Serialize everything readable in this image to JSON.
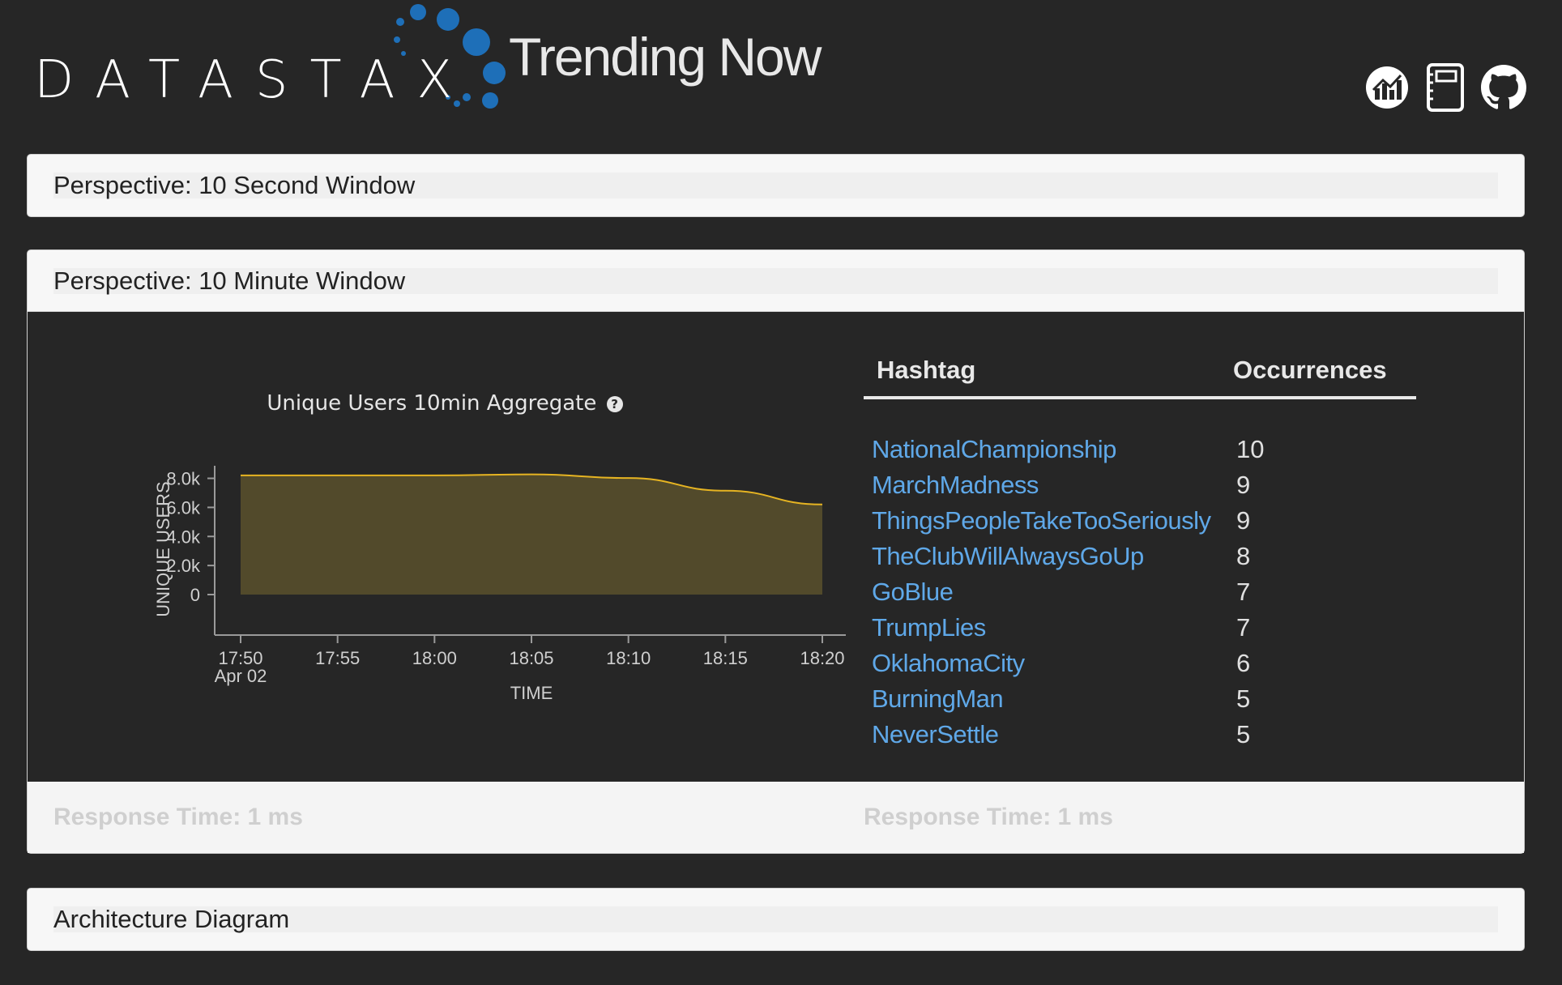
{
  "header": {
    "brand": "DATASTAX",
    "app_title": "Trending Now",
    "icons": [
      "analytics-icon",
      "notebook-icon",
      "github-icon"
    ]
  },
  "panels": {
    "second_window": {
      "title": "Perspective: 10 Second Window"
    },
    "minute_window": {
      "title": "Perspective: 10 Minute Window",
      "chart_title": "Unique Users 10min Aggregate",
      "footer_left": "Response Time: 1 ms",
      "footer_right": "Response Time: 1 ms"
    },
    "architecture": {
      "title": "Architecture Diagram"
    }
  },
  "hashtags": {
    "header_tag": "Hashtag",
    "header_count": "Occurrences",
    "rows": [
      {
        "tag": "NationalChampionship",
        "count": "10"
      },
      {
        "tag": "MarchMadness",
        "count": "9"
      },
      {
        "tag": "ThingsPeopleTakeTooSeriously",
        "count": "9"
      },
      {
        "tag": "TheClubWillAlwaysGoUp",
        "count": "8"
      },
      {
        "tag": "GoBlue",
        "count": "7"
      },
      {
        "tag": "TrumpLies",
        "count": "7"
      },
      {
        "tag": "OklahomaCity",
        "count": "6"
      },
      {
        "tag": "BurningMan",
        "count": "5"
      },
      {
        "tag": "NeverSettle",
        "count": "5"
      }
    ]
  },
  "chart_data": {
    "type": "area",
    "title": "Unique Users 10min Aggregate",
    "xlabel": "TIME",
    "ylabel": "UNIQUE USERS",
    "x": [
      "17:50",
      "17:55",
      "18:00",
      "18:05",
      "18:10",
      "18:15",
      "18:20"
    ],
    "x_sublabel": "Apr 02",
    "y_ticks": [
      "0",
      "2.0k",
      "4.0k",
      "6.0k",
      "8.0k"
    ],
    "y_tick_values": [
      0,
      2000,
      4000,
      6000,
      8000
    ],
    "ylim": [
      0,
      9200
    ],
    "series": [
      {
        "values": [
          8200,
          8200,
          8200,
          8270,
          8020,
          7150,
          6200
        ]
      }
    ],
    "colors": {
      "line": "#e6b422",
      "fill": "#524a2b",
      "axis": "#9a9a9a"
    }
  }
}
